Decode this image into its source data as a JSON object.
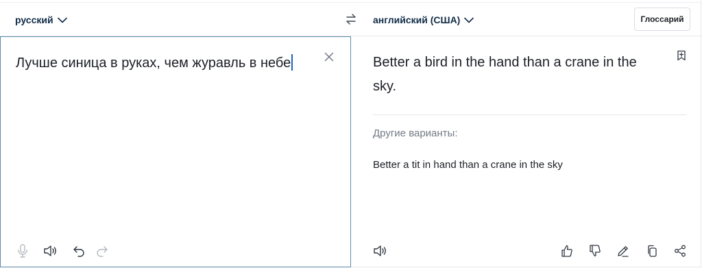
{
  "source": {
    "language": "русский",
    "text": "Лучше синица в руках, чем журавль в небе"
  },
  "target": {
    "language": "английский (США)",
    "translation": "Better a bird in the hand than a crane in the sky.",
    "alternatives_label": "Другие варианты:",
    "alternatives": [
      "Better a tit in hand than a crane in the sky"
    ]
  },
  "toolbar": {
    "glossary_label": "Глоссарий"
  },
  "colors": {
    "accent_border": "#5b8aa6",
    "language_text": "#0f2b46",
    "muted_text": "#737a84"
  },
  "icons": {
    "swap": "swap-arrows-icon",
    "chevron": "chevron-down-icon",
    "clear": "close-icon",
    "bookmark": "bookmark-add-icon",
    "mic": "microphone-icon",
    "speaker": "speaker-icon",
    "undo": "undo-icon",
    "redo": "redo-icon",
    "like": "thumbs-up-icon",
    "dislike": "thumbs-down-icon",
    "edit": "pencil-icon",
    "copy": "copy-icon",
    "share": "share-icon"
  }
}
